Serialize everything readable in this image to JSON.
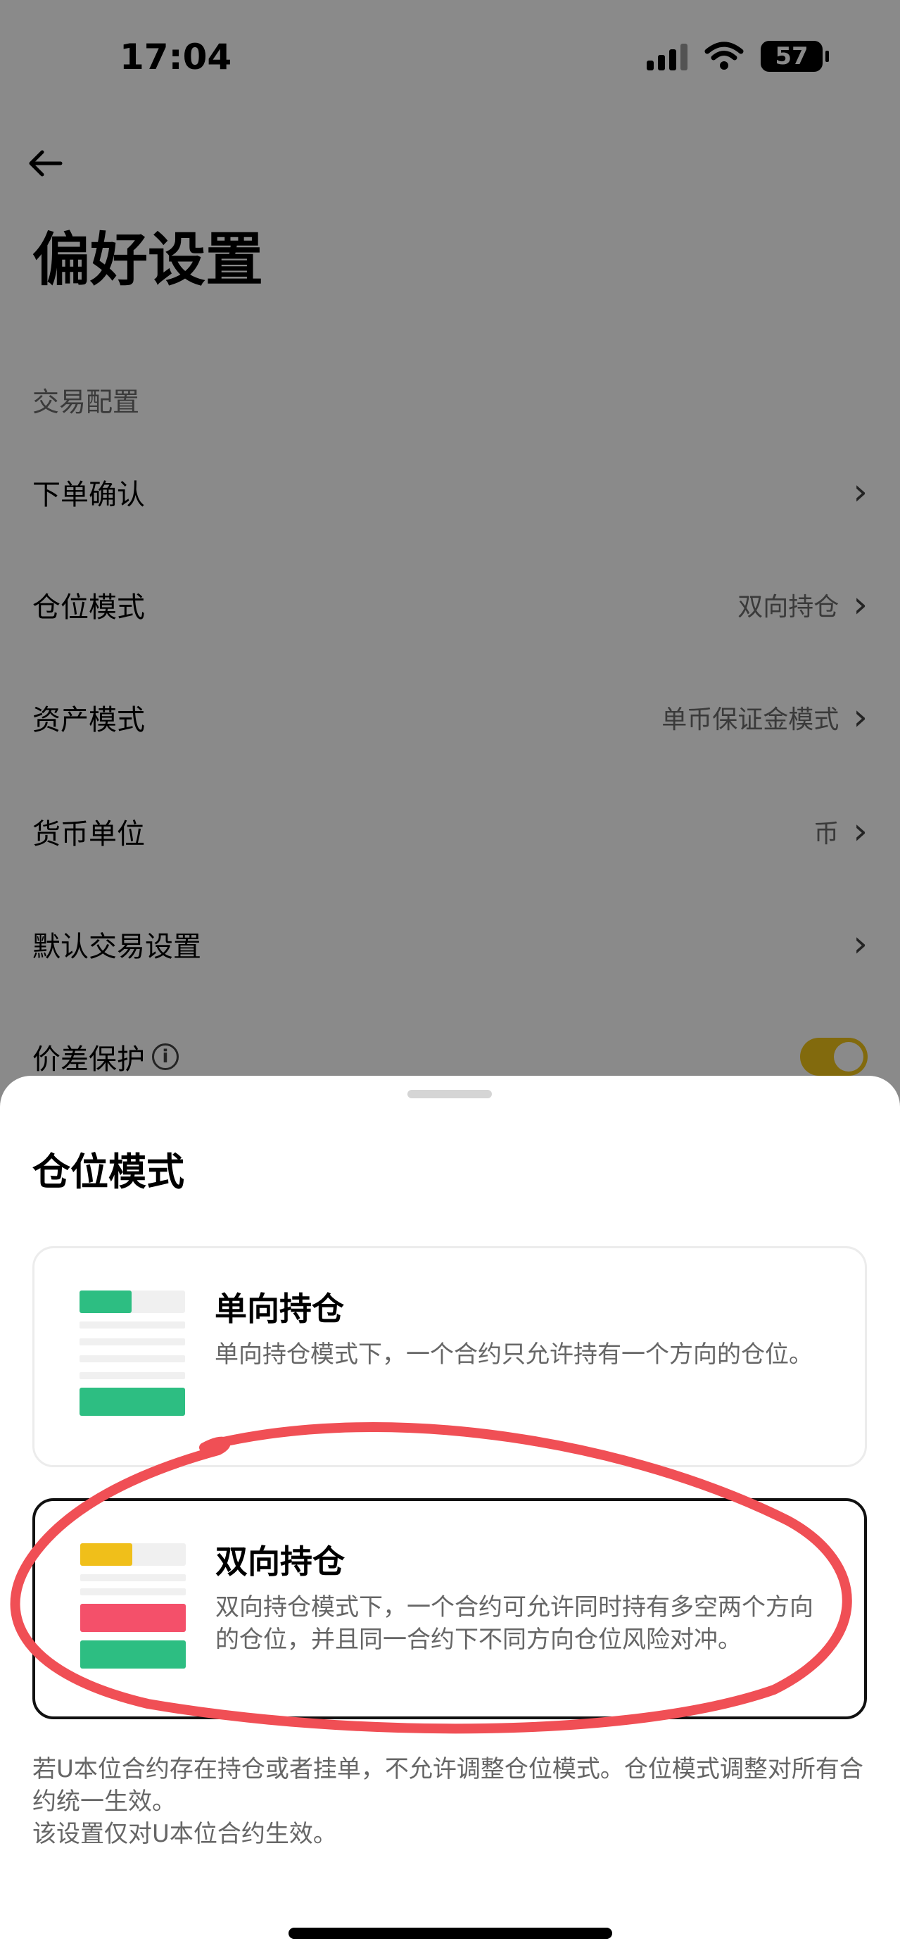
{
  "status_bar": {
    "time": "17:04",
    "battery": "57",
    "icons": [
      "signal-icon",
      "wifi-icon",
      "battery-icon"
    ]
  },
  "header": {
    "back_icon": "arrow-left-icon",
    "title": "偏好设置"
  },
  "section": {
    "label": "交易配置"
  },
  "settings": [
    {
      "label": "下单确认",
      "value": ""
    },
    {
      "label": "仓位模式",
      "value": "双向持仓"
    },
    {
      "label": "资产模式",
      "value": "单币保证金模式"
    },
    {
      "label": "货币单位",
      "value": "币"
    },
    {
      "label": "默认交易设置",
      "value": ""
    }
  ],
  "price_protection": {
    "label": "价差保护",
    "enabled": true
  },
  "sheet": {
    "title": "仓位模式",
    "options": [
      {
        "title": "单向持仓",
        "description": "单向持仓模式下，一个合约只允许持有一个方向的仓位。",
        "selected": false
      },
      {
        "title": "双向持仓",
        "description": "双向持仓模式下，一个合约可允许同时持有多空两个方向的仓位，并且同一合约下不同方向仓位风险对冲。",
        "selected": true
      }
    ],
    "note_line1": "若U本位合约存在持仓或者挂单，不允许调整仓位模式。仓位模式调整对所有合约统一生效。",
    "note_line2": "该设置仅对U本位合约生效。"
  },
  "colors": {
    "green": "#2dbe82",
    "yellow": "#f0bf1a",
    "red": "#f4506a",
    "toggle": "#f0c419",
    "annotation": "#f04f55"
  }
}
